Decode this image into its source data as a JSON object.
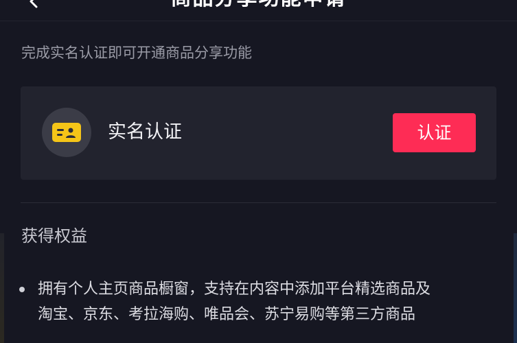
{
  "header": {
    "title": "商品分享功能申请",
    "back_icon": "chevron-left-icon"
  },
  "hint": "完成实名认证即可开通商品分享功能",
  "verification_card": {
    "icon": "id-card-icon",
    "title": "实名认证",
    "button_label": "认证",
    "accent_color": "#fe2c55",
    "icon_color": "#f5c518"
  },
  "benefits": {
    "section_title": "获得权益",
    "items": [
      {
        "line1": "拥有个人主页商品橱窗，支持在内容中添加平台精选商品及",
        "line2": "淘宝、京东、考拉海购、唯品会、苏宁易购等第三方商品"
      }
    ]
  }
}
